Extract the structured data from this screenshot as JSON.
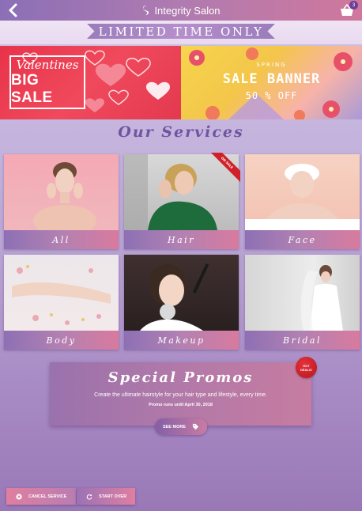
{
  "header": {
    "brand_name": "Integrity Salon",
    "back_icon": "chevron-left-icon",
    "cart_icon": "basket-icon",
    "cart_count": "3"
  },
  "limited_banner": {
    "text": "LIMITED TIME ONLY"
  },
  "promo_banners": [
    {
      "script": "Valentines",
      "title": "BIG SALE"
    },
    {
      "small": "SPRING",
      "title": "SALE BANNER",
      "discount": "50 % OFF"
    }
  ],
  "services": {
    "title": "Our Services",
    "tiles": [
      {
        "label": "All"
      },
      {
        "label": "Hair",
        "ribbon": "ON SALE"
      },
      {
        "label": "Face"
      },
      {
        "label": "Body"
      },
      {
        "label": "Makeup"
      },
      {
        "label": "Bridal"
      }
    ]
  },
  "special_promos": {
    "title": "Special Promos",
    "description": "Create the ultimate hairstyle for your hair type and lifestyle, every time.",
    "until": "Promo runs until April 30, 2018",
    "badge_line1": "HOT",
    "badge_line2": "DEALS!",
    "see_more_label": "SEE MORE",
    "see_more_icon": "tag-icon"
  },
  "bottom_actions": {
    "cancel_label": "CANCEL SERVICE",
    "cancel_icon": "close-circle-icon",
    "start_over_label": "START OVER",
    "start_over_icon": "refresh-icon"
  },
  "colors": {
    "accent_purple": "#8b6fb6",
    "accent_pink": "#d0779c",
    "title_purple": "#6f55a0",
    "hot_red": "#d0202a"
  }
}
